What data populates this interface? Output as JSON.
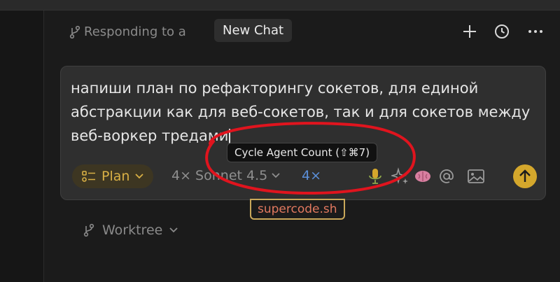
{
  "header": {
    "responding_label": "Responding to a",
    "tab_label": "New Chat",
    "icons": [
      "plus-icon",
      "history-icon",
      "more-icon"
    ]
  },
  "composer": {
    "text": "напиши план по рефакторингу сокетов, для единой абстракции как для веб-сокетов, так и для сокетов между веб-воркер тредами",
    "tooltip": "Cycle Agent Count (⇧⌘7)",
    "mode_label": "Plan",
    "model_label": "4× Sonnet 4.5",
    "agent_count": "4×",
    "tool_icons": [
      "mic-icon",
      "sparkles-icon",
      "brain-icon",
      "at-icon",
      "image-icon"
    ],
    "send_icon": "arrow-up-icon"
  },
  "watermark": {
    "label": "supercode.sh"
  },
  "footer": {
    "worktree_label": "Worktree"
  },
  "colors": {
    "background": "#1b1b1b",
    "card": "#2f2f2f",
    "accent_yellow": "#d4a72c",
    "agent_count_blue": "#5b8fd8",
    "annotation_red": "#e0141e"
  }
}
